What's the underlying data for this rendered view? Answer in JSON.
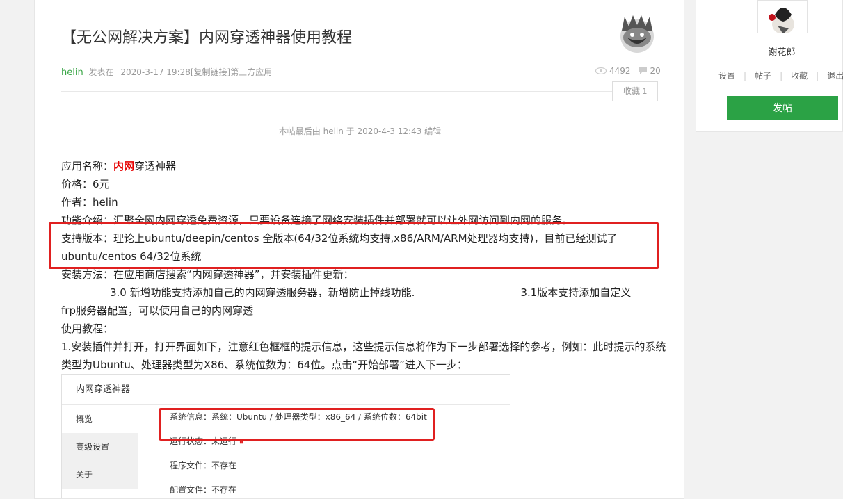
{
  "post": {
    "title": "【无公网解决方案】内网穿透神器使用教程",
    "author": "helin",
    "posted_label": "发表在",
    "date": "2020-3-17 19:28",
    "copy_link": "[复制链接]",
    "category": "第三方应用",
    "views": "4492",
    "replies": "20",
    "favorite_button": "收藏 1",
    "edit_note": "本帖最后由 helin 于 2020-4-3 12:43 编辑"
  },
  "content": {
    "app_name_prefix": "应用名称：",
    "app_name_highlight": "内网",
    "app_name_suffix": "穿透神器",
    "price": "价格：6元",
    "author_line": "作者：helin",
    "feature": "功能介绍：汇聚全网内网穿透免费资源，只要设备连接了网络安装插件并部署就可以让外网访问到内网的服务。",
    "support_1": "支持版本：理论上ubuntu/deepin/centos 全版本(64/32位系统均支持,x86/ARM/ARM处理器均支持)，目前已经测试了",
    "support_2": "ubuntu/centos 64/32位系统",
    "install": "安装方法：在应用商店搜索“内网穿透神器”，并安装插件更新：",
    "update_30": "3.0 新增功能支持添加自己的内网穿透服务器，新增防止掉线功能.",
    "update_31": "3.1版本支持添加自定义",
    "update_31_cont": "frp服务器配置，可以使用自己的内网穿透",
    "tutorial": "使用教程：",
    "step1": "1.安装插件并打开，打开界面如下，注意红色框框的提示信息，这些提示信息将作为下一步部署选择的参考，例如：此时提示的系统类型为Ubuntu、处理器类型为X86、系统位数为：64位。点击“开始部署”进入下一步："
  },
  "screenshot": {
    "window_title": "内网穿透神器",
    "menu": [
      "概览",
      "高级设置",
      "关于"
    ],
    "sys_info": "系统信息：系统：Ubuntu / 处理器类型：x86_64 / 系统位数：64bit",
    "run_status_label": "运行状态：未运行",
    "run_status_icon": "⏸",
    "program_file": "程序文件：不存在",
    "config_file": "配置文件：不存在"
  },
  "sidebar": {
    "username": "谢花郎",
    "links": [
      "设置",
      "帖子",
      "收藏",
      "退出"
    ],
    "post_button": "发帖"
  },
  "colors": {
    "accent_green": "#2ba245",
    "highlight_red": "#e60000",
    "box_red": "#e02020"
  }
}
